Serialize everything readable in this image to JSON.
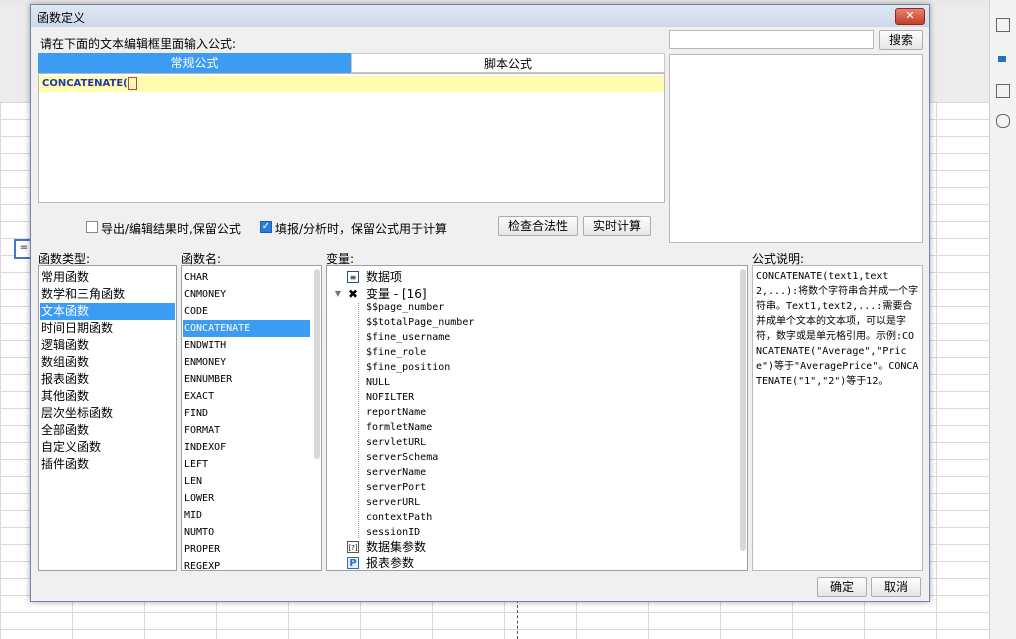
{
  "dialog": {
    "title": "函数定义",
    "close_label": "✕",
    "prompt": "请在下面的文本编辑框里面输入公式:",
    "tabs": [
      "常规公式",
      "脚本公式"
    ],
    "editor_text": "CONCATENATE(",
    "search_placeholder": "",
    "search_label": "搜索",
    "checkbox_export": "导出/编辑结果时,保留公式",
    "checkbox_fill": "填报/分析时，保留公式用于计算",
    "check_validity": "检查合法性",
    "realtime_calc": "实时计算",
    "ok": "确定",
    "cancel": "取消"
  },
  "categories": {
    "label": "函数类型:",
    "items": [
      "常用函数",
      "数学和三角函数",
      "文本函数",
      "时间日期函数",
      "逻辑函数",
      "数组函数",
      "报表函数",
      "其他函数",
      "层次坐标函数",
      "全部函数",
      "自定义函数",
      "插件函数"
    ],
    "selected": 2
  },
  "functions": {
    "label": "函数名:",
    "items": [
      "CHAR",
      "CNMONEY",
      "CODE",
      "CONCATENATE",
      "ENDWITH",
      "ENMONEY",
      "ENNUMBER",
      "EXACT",
      "FIND",
      "FORMAT",
      "INDEXOF",
      "LEFT",
      "LEN",
      "LOWER",
      "MID",
      "NUMTO",
      "PROPER",
      "REGEXP"
    ],
    "selected": 3
  },
  "variables": {
    "label": "变量:",
    "data_item": "数据项",
    "var_group": "变量 - [16]",
    "var_items": [
      "$$page_number",
      "$$totalPage_number",
      "$fine_username",
      "$fine_role",
      "$fine_position",
      "NULL",
      "NOFILTER",
      "reportName",
      "formletName",
      "servletURL",
      "serverSchema",
      "serverName",
      "serverPort",
      "serverURL",
      "contextPath",
      "sessionID"
    ],
    "dataset_params": "数据集参数",
    "report_params": "报表参数"
  },
  "explanation": {
    "label": "公式说明:",
    "text": "CONCATENATE(text1,text2,...):将数个字符串合并成一个字符串。Text1,text2,...:需要合并成单个文本的文本项，可以是字符，数字或是单元格引用。示例:CONCATENATE(\"Average\",\"Price\")等于\"AveragePrice\"。CONCATENATE(\"1\",\"2\")等于12。"
  },
  "background": {
    "cell_marker": "="
  }
}
